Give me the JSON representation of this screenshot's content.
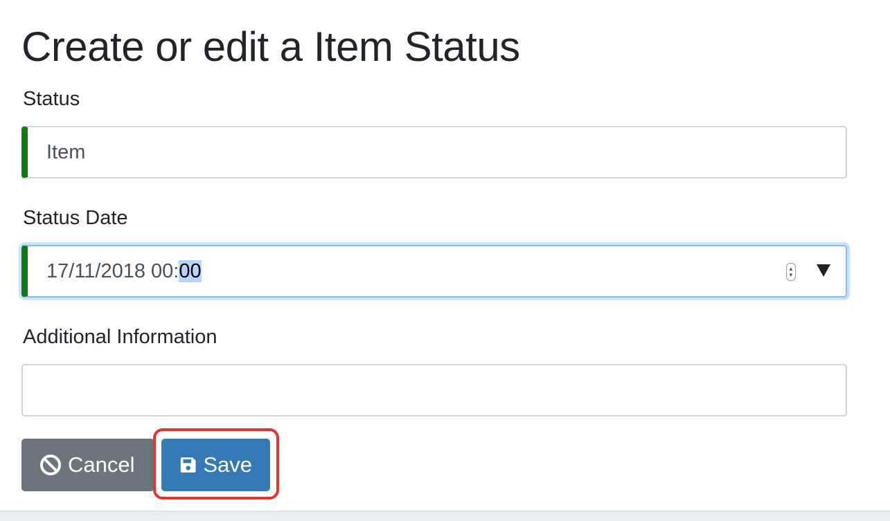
{
  "page": {
    "title": "Create or edit a Item Status"
  },
  "form": {
    "status": {
      "label": "Status",
      "value": "Item"
    },
    "status_date": {
      "label": "Status Date",
      "value_prefix": "17/11/2018 00:",
      "value_selected": "00"
    },
    "additional_information": {
      "label": "Additional Information",
      "value": ""
    }
  },
  "buttons": {
    "cancel_label": "Cancel",
    "cancel_icon": "ban-icon",
    "save_label": "Save",
    "save_icon": "floppy-disk-icon"
  },
  "colors": {
    "valid_indicator": "#107c10",
    "cancel_button": "#6c757d",
    "save_button": "#337ab7",
    "highlight_outline": "#e8322c"
  }
}
